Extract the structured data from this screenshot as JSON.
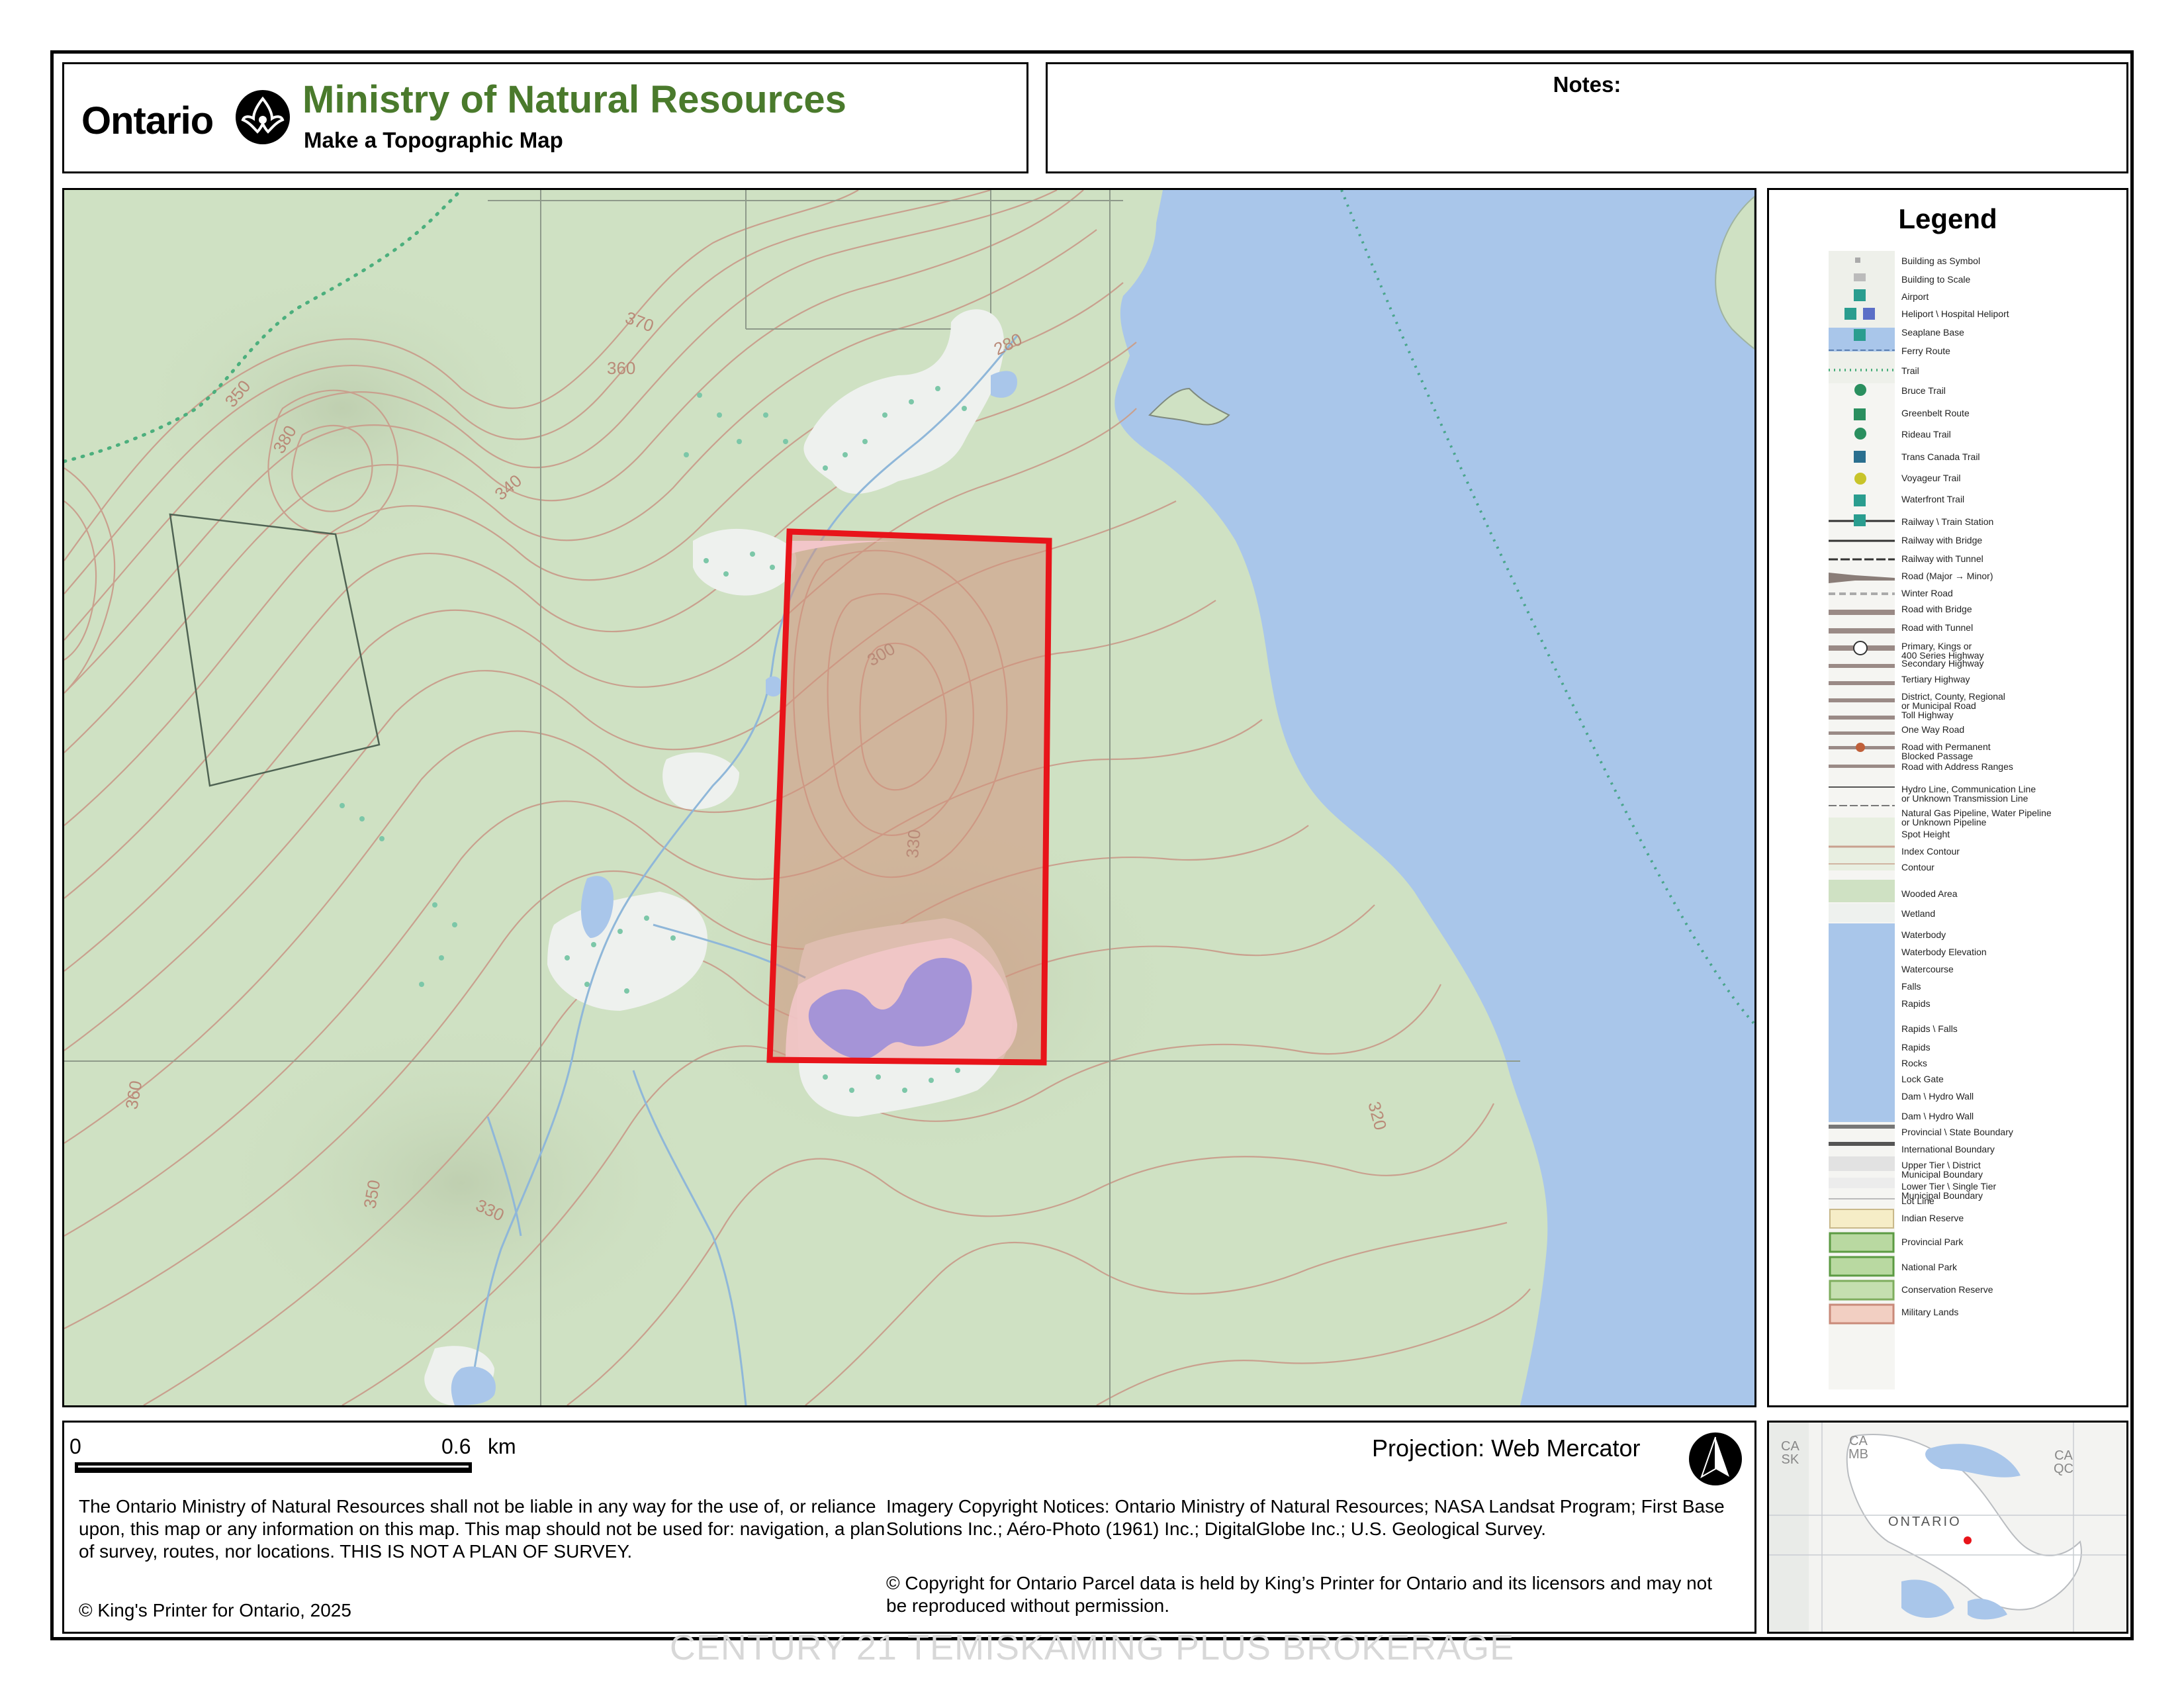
{
  "header": {
    "ontario_word": "Ontario",
    "ministry_title": "Ministry of Natural Resources",
    "subtitle": "Make a Topographic Map"
  },
  "notes": {
    "label": "Notes:"
  },
  "map": {
    "contour_labels": [
      "370",
      "360",
      "350",
      "380",
      "340",
      "280",
      "300",
      "330",
      "360",
      "350",
      "330",
      "320"
    ],
    "colors": {
      "land": "#cfe1c3",
      "land_light": "#dbe9cf",
      "water": "#a9c6ea",
      "contour": "#c9a08e",
      "parcel_outline": "#e8141a",
      "parcel_fill": "#d2917c",
      "wetland": "#eef1ee",
      "trail": "#4caf7d",
      "lot_line": "#8e9a8a"
    }
  },
  "legend": {
    "title": "Legend",
    "items": [
      "Building as Symbol",
      "Building to Scale",
      "Airport",
      "Heliport \\ Hospital Heliport",
      "Seaplane Base",
      "Ferry Route",
      "Trail",
      "Bruce Trail",
      "Greenbelt Route",
      "Rideau Trail",
      "Trans Canada Trail",
      "Voyageur Trail",
      "Waterfront Trail",
      "Railway \\ Train Station",
      "Railway with Bridge",
      "Railway with Tunnel",
      "Road (Major → Minor)",
      "Winter Road",
      "Road with Bridge",
      "Road with Tunnel",
      "Primary, Kings or\n400 Series Highway",
      "Secondary Highway",
      "Tertiary Highway",
      "District, County, Regional\nor Municipal Road",
      "Toll Highway",
      "One Way Road",
      "Road with Permanent\nBlocked Passage",
      "Road with Address Ranges",
      "Hydro Line, Communication Line\nor Unknown Transmission Line",
      "Natural Gas Pipeline, Water Pipeline\nor Unknown Pipeline",
      "Spot Height",
      "Index Contour",
      "Contour",
      "Wooded Area",
      "Wetland",
      "Waterbody",
      "Waterbody Elevation",
      "Watercourse",
      "Falls",
      "Rapids",
      "Rapids \\ Falls",
      "Rapids",
      "Rocks",
      "Lock Gate",
      "Dam \\ Hydro Wall",
      "Dam \\ Hydro Wall",
      "Provincial \\ State Boundary",
      "International Boundary",
      "Upper Tier \\ District\nMunicipal Boundary",
      "Lower Tier \\ Single Tier\nMunicipal Boundary",
      "Lot Line",
      "Indian Reserve",
      "Provincial Park",
      "National Park",
      "Conservation Reserve",
      "Military Lands"
    ]
  },
  "footer": {
    "scale_start": "0",
    "scale_end": "0.6",
    "scale_unit": "km",
    "projection": "Projection: Web Mercator",
    "disclaimer": "The Ontario Ministry of Natural Resources shall not be liable in any way for the use of, or reliance upon, this map or any information on this map.  This map should not be used for: navigation, a plan of survey, routes, nor locations. THIS IS NOT A PLAN OF SURVEY.",
    "copyright": "© King's Printer for Ontario,  2025",
    "imagery_notice": "Imagery Copyright Notices: Ontario Ministry of Natural Resources; NASA Landsat Program; First Base Solutions Inc.; Aéro-Photo (1961) Inc.; DigitalGlobe Inc.; U.S. Geological Survey.",
    "parcel_notice": "© Copyright for Ontario Parcel data is held by King’s Printer for Ontario and its licensors and may not be reproduced without permission."
  },
  "inset": {
    "labels": [
      "CA\nSK",
      "CA\nMB",
      "CA\nQC",
      "ONTARIO"
    ]
  },
  "watermark": "CENTURY 21 TEMISKAMING PLUS BROKERAGE"
}
